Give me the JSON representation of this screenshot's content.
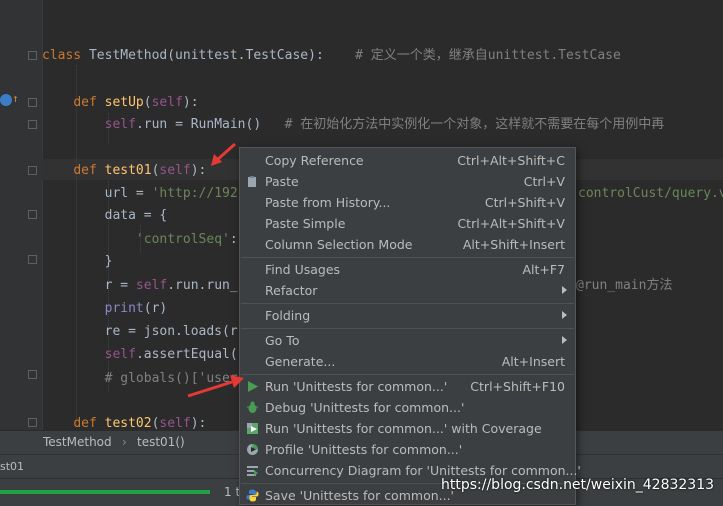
{
  "code_lines": [
    {
      "id": "l1",
      "parts": [
        {
          "t": "class ",
          "c": "kw"
        },
        {
          "t": "TestMethod(unittest.TestCase):",
          "c": ""
        },
        {
          "t": "    # 定义一个类，继承自unittest.TestCase",
          "c": "cmt"
        }
      ]
    },
    {
      "id": "l2",
      "parts": [
        {
          "t": "    "
        },
        {
          "t": "def ",
          "c": "kw"
        },
        {
          "t": "setUp",
          "c": "fn"
        },
        {
          "t": "(",
          "c": ""
        },
        {
          "t": "self",
          "c": "self"
        },
        {
          "t": "):",
          "c": ""
        }
      ]
    },
    {
      "id": "l3",
      "parts": [
        {
          "t": "        "
        },
        {
          "t": "self",
          "c": "self"
        },
        {
          "t": ".run = RunMain()",
          "c": ""
        },
        {
          "t": "   # 在初始化方法中实例化一个对象，这样就不需要在每个用例中再",
          "c": "cmt"
        }
      ]
    },
    {
      "id": "l4",
      "parts": [
        {
          "t": "    "
        },
        {
          "t": "def ",
          "c": "kw"
        },
        {
          "t": "test01",
          "c": "fn"
        },
        {
          "t": "(",
          "c": ""
        },
        {
          "t": "self",
          "c": "self"
        },
        {
          "t": "):",
          "c": ""
        }
      ]
    },
    {
      "id": "l5",
      "parts": [
        {
          "t": "        url = "
        },
        {
          "t": "'http://192",
          "c": "str"
        }
      ]
    },
    {
      "id": "l5b",
      "parts": [
        {
          "t": "controlCust/query.v",
          "c": "str"
        }
      ]
    },
    {
      "id": "l6",
      "parts": [
        {
          "t": "        data = {"
        }
      ]
    },
    {
      "id": "l7",
      "parts": [
        {
          "t": "            "
        },
        {
          "t": "'controlSeq'",
          "c": "str"
        },
        {
          "t": ":"
        }
      ]
    },
    {
      "id": "l8",
      "parts": [
        {
          "t": "        }"
        }
      ]
    },
    {
      "id": "l9",
      "parts": [
        {
          "t": "        r = "
        },
        {
          "t": "self",
          "c": "self"
        },
        {
          "t": ".run.run_"
        }
      ]
    },
    {
      "id": "l9b",
      "parts": [
        {
          "t": "@run_main方法",
          "c": "cmt"
        }
      ]
    },
    {
      "id": "l10",
      "parts": [
        {
          "t": "        "
        },
        {
          "t": "print",
          "c": "bi"
        },
        {
          "t": "(r)"
        }
      ]
    },
    {
      "id": "l11",
      "parts": [
        {
          "t": "        re = json.loads(r"
        }
      ]
    },
    {
      "id": "l12",
      "parts": [
        {
          "t": "        "
        },
        {
          "t": "self",
          "c": "self"
        },
        {
          "t": ".assertEqual("
        }
      ]
    },
    {
      "id": "l13",
      "parts": [
        {
          "t": "        # globals()['user",
          "c": "cmt"
        }
      ]
    },
    {
      "id": "l14",
      "parts": [
        {
          "t": "    "
        },
        {
          "t": "def ",
          "c": "kw"
        },
        {
          "t": "test02",
          "c": "fn"
        },
        {
          "t": "(",
          "c": ""
        },
        {
          "t": "self",
          "c": "self"
        },
        {
          "t": "):",
          "c": ""
        }
      ]
    }
  ],
  "breadcrumb": {
    "class_name": "TestMethod",
    "separator": "›",
    "method_name": "test01()"
  },
  "tabbar": {
    "label": "st01"
  },
  "status": {
    "text": "1 t",
    "progress_fraction": 0.29
  },
  "watermark": "https://blog.csdn.net/weixin_42832313",
  "menu": {
    "items": [
      {
        "id": "copy-reference",
        "label": "Copy Reference",
        "shortcut": "Ctrl+Alt+Shift+C"
      },
      {
        "id": "paste",
        "label": "Paste",
        "shortcut": "Ctrl+V",
        "icon": "paste-icon"
      },
      {
        "id": "paste-history",
        "label": "Paste from History...",
        "shortcut": "Ctrl+Shift+V"
      },
      {
        "id": "paste-simple",
        "label": "Paste Simple",
        "shortcut": "Ctrl+Alt+Shift+V"
      },
      {
        "id": "column-selection",
        "label": "Column Selection Mode",
        "shortcut": "Alt+Shift+Insert"
      },
      {
        "id": "find-usages",
        "label": "Find Usages",
        "shortcut": "Alt+F7"
      },
      {
        "id": "refactor",
        "label": "Refactor",
        "submenu": true
      },
      {
        "id": "folding",
        "label": "Folding",
        "submenu": true
      },
      {
        "id": "go-to",
        "label": "Go To",
        "submenu": true
      },
      {
        "id": "generate",
        "label": "Generate...",
        "shortcut": "Alt+Insert"
      },
      {
        "id": "run",
        "label": "Run 'Unittests for common...'",
        "shortcut": "Ctrl+Shift+F10",
        "icon": "run-icon"
      },
      {
        "id": "debug",
        "label": "Debug 'Unittests for common...'",
        "icon": "debug-icon"
      },
      {
        "id": "coverage",
        "label": "Run 'Unittests for common...' with Coverage",
        "icon": "coverage-icon"
      },
      {
        "id": "profile",
        "label": "Profile 'Unittests for common...'",
        "icon": "profile-icon"
      },
      {
        "id": "concurrency",
        "label": "Concurrency Diagram for 'Unittests for common...'",
        "icon": "concurrency-icon"
      },
      {
        "id": "save",
        "label": "Save 'Unittests for common...'",
        "icon": "python-icon"
      }
    ]
  },
  "colors": {
    "accent_run": "#499c54",
    "annotation_arrow": "#e53935"
  }
}
